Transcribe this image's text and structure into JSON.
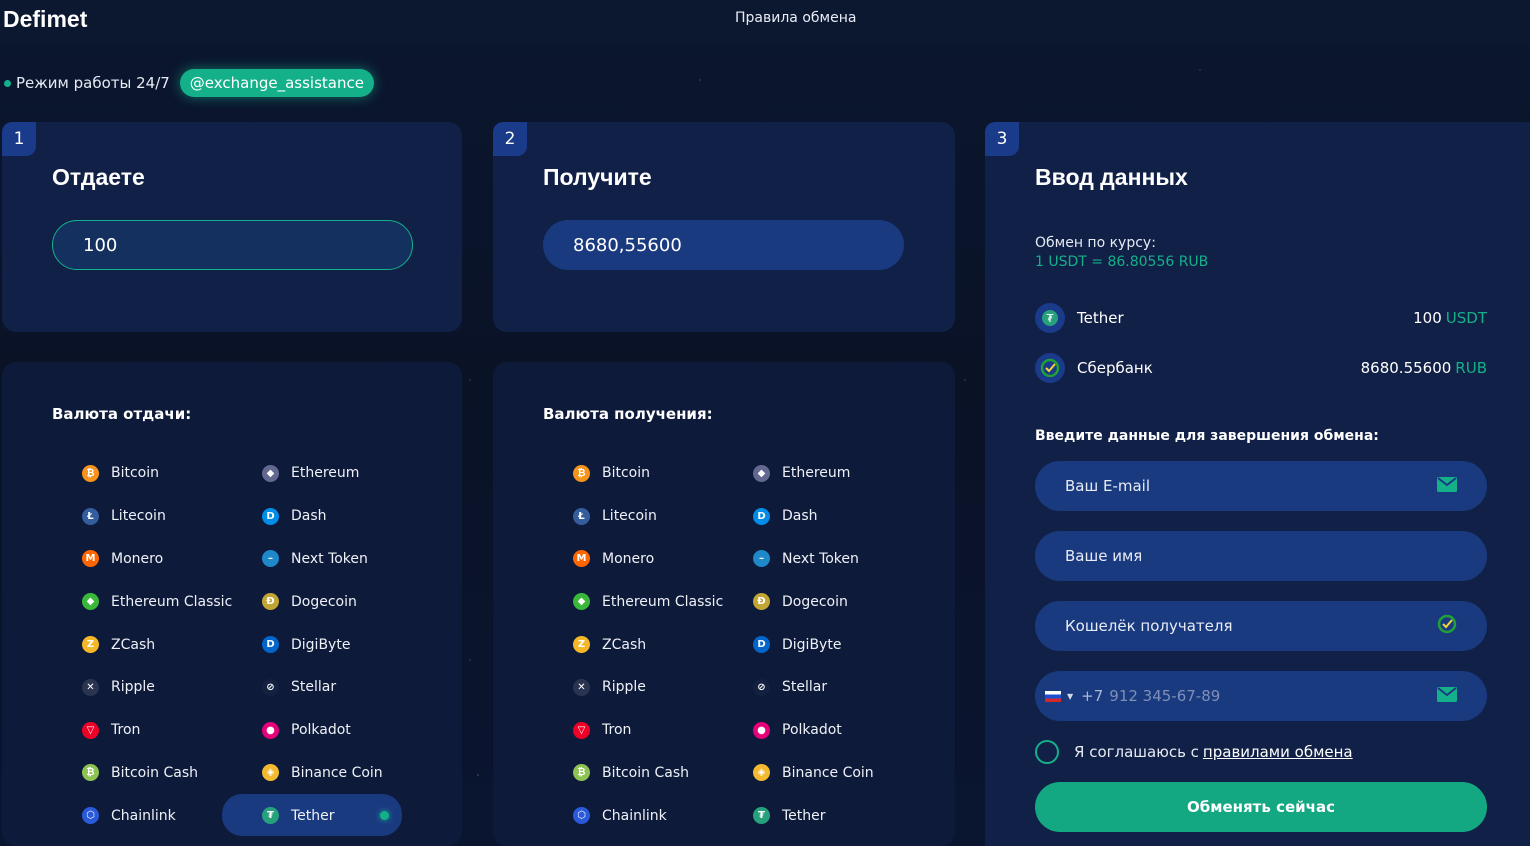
{
  "header": {
    "logo": "Defimet",
    "rules_link": "Правила обмена"
  },
  "status": {
    "text": "Режим работы 24/7",
    "telegram": "@exchange_assistance"
  },
  "step1": {
    "number": "1",
    "title": "Отдаете",
    "amount": "100"
  },
  "step2": {
    "number": "2",
    "title": "Получите",
    "amount": "8680,55600"
  },
  "give_list": {
    "title": "Валюта отдачи:",
    "coins": [
      "Bitcoin",
      "Ethereum",
      "Litecoin",
      "Dash",
      "Monero",
      "Next Token",
      "Ethereum Classic",
      "Dogecoin",
      "ZCash",
      "DigiByte",
      "Ripple",
      "Stellar",
      "Tron",
      "Polkadot",
      "Bitcoin Cash",
      "Binance Coin",
      "Chainlink",
      "Tether"
    ],
    "selected": "Tether"
  },
  "receive_list": {
    "title": "Валюта получения:",
    "coins": [
      "Bitcoin",
      "Ethereum",
      "Litecoin",
      "Dash",
      "Monero",
      "Next Token",
      "Ethereum Classic",
      "Dogecoin",
      "ZCash",
      "DigiByte",
      "Ripple",
      "Stellar",
      "Tron",
      "Polkadot",
      "Bitcoin Cash",
      "Binance Coin",
      "Chainlink",
      "Tether"
    ]
  },
  "step3": {
    "number": "3",
    "title": "Ввод данных",
    "rate_label": "Обмен по курсу:",
    "rate_value": "1 USDT = 86.80556 RUB",
    "give": {
      "name": "Tether",
      "amount": "100",
      "currency": "USDT"
    },
    "receive": {
      "name": "Сбербанк",
      "amount": "8680.55600",
      "currency": "RUB"
    },
    "form_title": "Введите данные для завершения обмена:",
    "email_placeholder": "Ваш E-mail",
    "name_placeholder": "Ваше имя",
    "wallet_placeholder": "Кошелёк получателя",
    "phone_prefix": "+7",
    "phone_placeholder": "912 345-67-89",
    "agree_text": "Я соглашаюсь с",
    "agree_link": "правилами обмена",
    "submit": "Обменять сейчас"
  },
  "coin_icons": {
    "Bitcoin": {
      "bg": "#f7931a",
      "glyph": "₿"
    },
    "Ethereum": {
      "bg": "#626890",
      "glyph": "◆"
    },
    "Litecoin": {
      "bg": "#345d9d",
      "glyph": "Ł"
    },
    "Dash": {
      "bg": "#008ce7",
      "glyph": "D"
    },
    "Monero": {
      "bg": "#ff6600",
      "glyph": "M"
    },
    "Next Token": {
      "bg": "#1e88c8",
      "glyph": "–"
    },
    "Ethereum Classic": {
      "bg": "#3ab83a",
      "glyph": "◆"
    },
    "Dogecoin": {
      "bg": "#c2a633",
      "glyph": "Ð"
    },
    "ZCash": {
      "bg": "#f4b728",
      "glyph": "Z"
    },
    "DigiByte": {
      "bg": "#0066cc",
      "glyph": "D"
    },
    "Ripple": {
      "bg": "#2a3350",
      "glyph": "✕"
    },
    "Stellar": {
      "bg": "#14203f",
      "glyph": "⊘"
    },
    "Tron": {
      "bg": "#ef0027",
      "glyph": "▽"
    },
    "Polkadot": {
      "bg": "#e6007a",
      "glyph": "●"
    },
    "Bitcoin Cash": {
      "bg": "#8dc351",
      "glyph": "₿"
    },
    "Binance Coin": {
      "bg": "#f3ba2f",
      "glyph": "◈"
    },
    "Chainlink": {
      "bg": "#2a5ada",
      "glyph": "⬡"
    },
    "Tether": {
      "bg": "#26a17b",
      "glyph": "₮"
    }
  }
}
